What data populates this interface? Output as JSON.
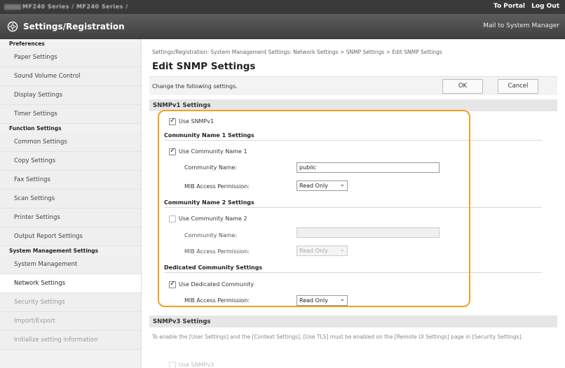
{
  "topbar": {
    "device": "MF240 Series / MF240 Series /",
    "portal": "To Portal",
    "logout": "Log Out"
  },
  "titlebar": {
    "title": "Settings/Registration",
    "mail": "Mail to System Manager"
  },
  "sidebar": {
    "preferences": "Preferences",
    "pref_items": [
      "Paper Settings",
      "Sound Volume Control",
      "Display Settings",
      "Timer Settings"
    ],
    "function": "Function Settings",
    "func_items": [
      "Common Settings",
      "Copy Settings",
      "Fax Settings",
      "Scan Settings",
      "Printer Settings",
      "Output Report Settings"
    ],
    "system": "System Management Settings",
    "sys_items": [
      "System Management",
      "Network Settings",
      "Security Settings",
      "Import/Export",
      "Initialize setting information"
    ]
  },
  "main": {
    "breadcrumb": "Settings/Registration: System Management Settings: Network Settings > SNMP Settings > Edit SNMP Settings",
    "heading": "Edit SNMP Settings",
    "change_text": "Change the following settings.",
    "ok": "OK",
    "cancel": "Cancel",
    "snmpv1_head": "SNMPv1 Settings",
    "use_snmpv1": "Use SNMPv1",
    "comm1_head": "Community Name 1 Settings",
    "use_comm1": "Use Community Name 1",
    "comm_name_label": "Community Name:",
    "comm1_value": "public",
    "mib_label": "MIB Access Permission:",
    "mib1_value": "Read Only",
    "comm2_head": "Community Name 2 Settings",
    "use_comm2": "Use Community Name 2",
    "comm2_name_label": "Community Name:",
    "mib2_label": "MIB Access Permission:",
    "mib2_value": "Read Only",
    "dedicated_head": "Dedicated Community Settings",
    "use_dedicated": "Use Dedicated Community",
    "mib3_label": "MIB Access Permission:",
    "mib3_value": "Read Only",
    "snmpv3_head": "SNMPv3 Settings",
    "snmpv3_note": "To enable the [User Settings] and the [Context Settings], [Use TLS] must be enabled on the [Remote UI Settings] page in [Security Settings].",
    "use_snmpv3": "Use SNMPv3"
  },
  "colors": {
    "highlight": "#f0a020",
    "topbar": "#3a3a3a",
    "titlebar": "#4b4b4b"
  }
}
